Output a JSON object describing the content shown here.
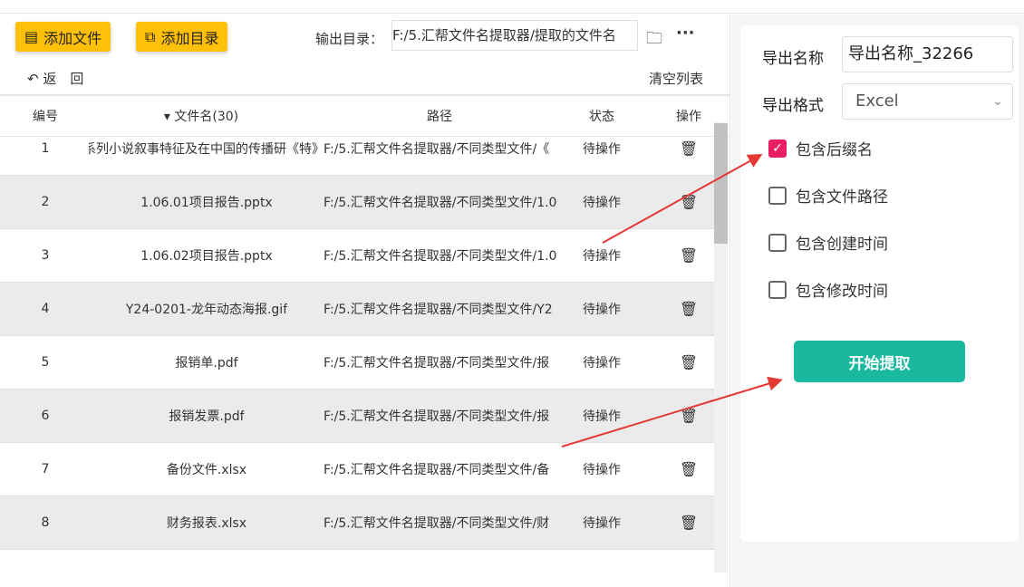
{
  "toolbar": {
    "add_file": "添加文件",
    "add_dir": "添加目录",
    "output_label": "输出目录：",
    "output_path": "F:/5.汇帮文件名提取器/提取的文件名",
    "back": "返　回",
    "clear": "清空列表"
  },
  "table": {
    "headers": {
      "index": "编号",
      "name": "文件名(30)",
      "path": "路径",
      "status": "状态",
      "action": "操作"
    },
    "rows": [
      {
        "index": "1",
        "name": "《特》系列小说叙事特征及在中国的传播研",
        "path": "F:/5.汇帮文件名提取器/不同类型文件/《",
        "status": "待操作"
      },
      {
        "index": "2",
        "name": "1.06.01项目报告.pptx",
        "path": "F:/5.汇帮文件名提取器/不同类型文件/1.0",
        "status": "待操作"
      },
      {
        "index": "3",
        "name": "1.06.02项目报告.pptx",
        "path": "F:/5.汇帮文件名提取器/不同类型文件/1.0",
        "status": "待操作"
      },
      {
        "index": "4",
        "name": "Y24-0201-龙年动态海报.gif",
        "path": "F:/5.汇帮文件名提取器/不同类型文件/Y2",
        "status": "待操作"
      },
      {
        "index": "5",
        "name": "报销单.pdf",
        "path": "F:/5.汇帮文件名提取器/不同类型文件/报",
        "status": "待操作"
      },
      {
        "index": "6",
        "name": "报销发票.pdf",
        "path": "F:/5.汇帮文件名提取器/不同类型文件/报",
        "status": "待操作"
      },
      {
        "index": "7",
        "name": "备份文件.xlsx",
        "path": "F:/5.汇帮文件名提取器/不同类型文件/备",
        "status": "待操作"
      },
      {
        "index": "8",
        "name": "财务报表.xlsx",
        "path": "F:/5.汇帮文件名提取器/不同类型文件/财",
        "status": "待操作"
      }
    ]
  },
  "settings": {
    "name_label": "导出名称",
    "name_value": "导出名称_32266",
    "format_label": "导出格式",
    "format_value": "Excel",
    "options": [
      {
        "label": "包含后缀名",
        "checked": true
      },
      {
        "label": "包含文件路径",
        "checked": false
      },
      {
        "label": "包含创建时间",
        "checked": false
      },
      {
        "label": "包含修改时间",
        "checked": false
      }
    ],
    "start": "开始提取"
  },
  "colors": {
    "accent": "#ffc107",
    "start": "#1ab99f",
    "check": "#e91e63",
    "arrow": "#e53935"
  }
}
